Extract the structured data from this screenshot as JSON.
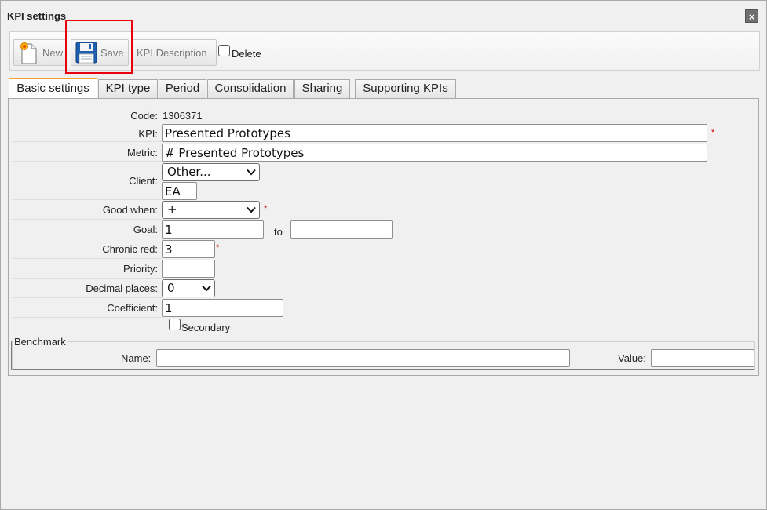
{
  "window": {
    "title": "KPI settings",
    "close_label": "×"
  },
  "toolbar": {
    "new_label": "New",
    "save_label": "Save",
    "description_label": "KPI Description",
    "delete_label": "Delete",
    "delete_checked": false
  },
  "tabs": [
    {
      "label": "Basic settings",
      "active": true
    },
    {
      "label": "KPI type",
      "active": false
    },
    {
      "label": "Period",
      "active": false
    },
    {
      "label": "Consolidation",
      "active": false
    },
    {
      "label": "Sharing",
      "active": false
    },
    {
      "label": "Supporting KPIs",
      "active": false
    }
  ],
  "form": {
    "code": {
      "label": "Code:",
      "value": "1306371"
    },
    "kpi": {
      "label": "KPI:",
      "value": "Presented Prototypes",
      "required": true
    },
    "metric": {
      "label": "Metric:",
      "value": "# Presented Prototypes"
    },
    "client": {
      "label": "Client:",
      "selected": "Other...",
      "text_value": "EA"
    },
    "good_when": {
      "label": "Good when:",
      "selected": "+",
      "required": true
    },
    "goal": {
      "label": "Goal:",
      "value": "1",
      "to_label": "to",
      "to_value": ""
    },
    "chronic_red": {
      "label": "Chronic red:",
      "value": "3",
      "required": true
    },
    "priority": {
      "label": "Priority:",
      "value": ""
    },
    "decimal_places": {
      "label": "Decimal places:",
      "selected": "0"
    },
    "coefficient": {
      "label": "Coefficient:",
      "value": "1"
    },
    "secondary": {
      "label": "Secondary",
      "checked": false
    },
    "required_mark": "*"
  },
  "benchmark": {
    "legend": "Benchmark",
    "name_label": "Name:",
    "name_value": "",
    "value_label": "Value:",
    "value_value": ""
  },
  "colors": {
    "required": "#d00000",
    "highlight": "#e8000d",
    "active_tab_accent": "#f0a030"
  }
}
